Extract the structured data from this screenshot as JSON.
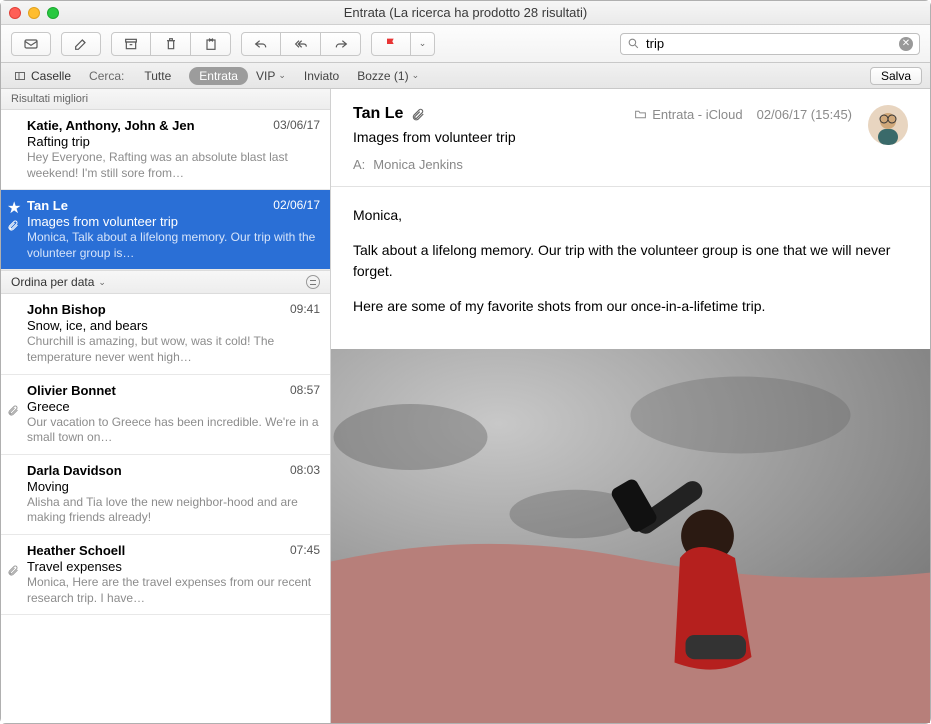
{
  "window": {
    "title": "Entrata (La ricerca ha prodotto 28 risultati)"
  },
  "toolbar": {
    "search_value": "trip"
  },
  "scopebar": {
    "caselle": "Caselle",
    "cerca": "Cerca:",
    "tabs": {
      "tutte": "Tutte",
      "entrata": "Entrata",
      "vip": "VIP",
      "inviato": "Inviato",
      "bozze": "Bozze (1)"
    },
    "salva": "Salva"
  },
  "list": {
    "section_top": "Risultati migliori",
    "sort_label": "Ordina per data",
    "messages": [
      {
        "from": "Katie, Anthony, John & Jen",
        "date": "03/06/17",
        "subject": "Rafting trip",
        "preview": "Hey Everyone, Rafting was an absolute blast last weekend! I'm still sore from…",
        "selected": false,
        "star": false,
        "clip": false
      },
      {
        "from": "Tan Le",
        "date": "02/06/17",
        "subject": "Images from volunteer trip",
        "preview": "Monica, Talk about a lifelong memory. Our trip with the volunteer group is…",
        "selected": true,
        "star": true,
        "clip": true
      },
      {
        "from": "John Bishop",
        "date": "09:41",
        "subject": "Snow, ice, and bears",
        "preview": "Churchill is amazing, but wow, was it cold! The temperature never went high…",
        "selected": false,
        "star": false,
        "clip": false
      },
      {
        "from": "Olivier Bonnet",
        "date": "08:57",
        "subject": "Greece",
        "preview": "Our vacation to Greece has been incredible. We're in a small town on…",
        "selected": false,
        "star": false,
        "clip": true
      },
      {
        "from": "Darla Davidson",
        "date": "08:03",
        "subject": "Moving",
        "preview": "Alisha and Tia love the new neighbor-hood and are making friends already!",
        "selected": false,
        "star": false,
        "clip": false
      },
      {
        "from": "Heather Schoell",
        "date": "07:45",
        "subject": "Travel expenses",
        "preview": "Monica, Here are the travel expenses from our recent research trip. I have…",
        "selected": false,
        "star": false,
        "clip": true
      }
    ]
  },
  "pane": {
    "from": "Tan Le",
    "folder": "Entrata - iCloud",
    "date": "02/06/17 (15:45)",
    "subject": "Images from volunteer trip",
    "to_label": "A:",
    "to_value": "Monica Jenkins",
    "body": [
      "Monica,",
      "Talk about a lifelong memory. Our trip with the volunteer group is one that we will never forget.",
      "Here are some of my favorite shots from our once-in-a-lifetime trip."
    ]
  }
}
